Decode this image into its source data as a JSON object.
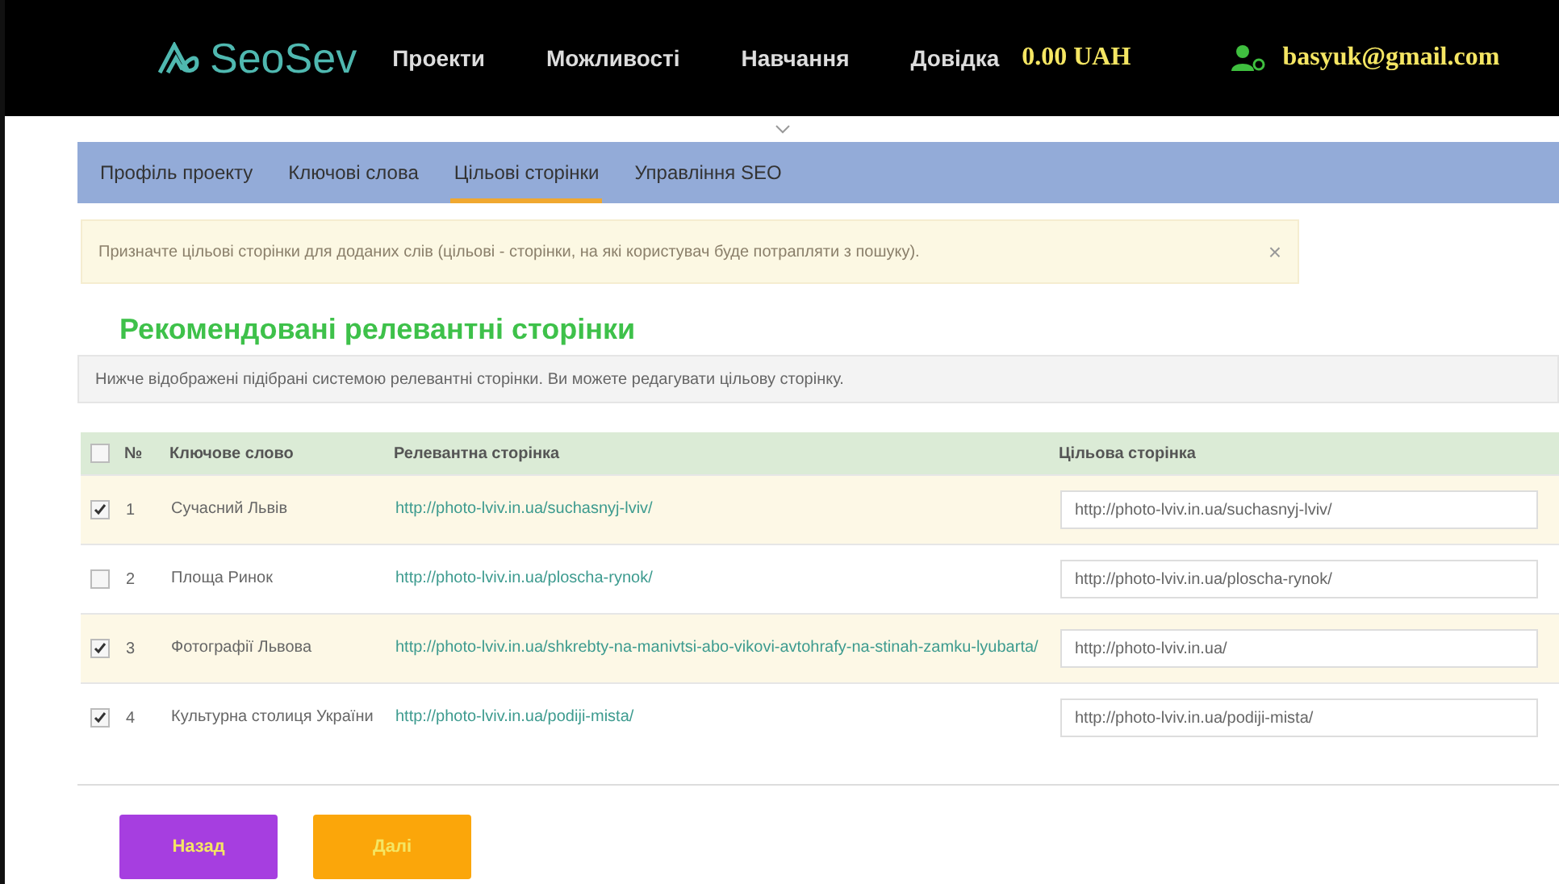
{
  "header": {
    "logo": "SeoSev",
    "menu": [
      "Проекти",
      "Можливості",
      "Навчання",
      "Довідка"
    ],
    "balance": "0.00 UAH",
    "user": "basyuk@gmail.com"
  },
  "tabs": [
    {
      "label": "Профіль проекту",
      "selected": false
    },
    {
      "label": "Ключові слова",
      "selected": false
    },
    {
      "label": "Цільові сторінки",
      "selected": true
    },
    {
      "label": "Управління SEO",
      "selected": false
    }
  ],
  "alert": {
    "text": "Призначте цільові сторінки для доданих слів (цільові - сторінки, на які користувач буде потрапляти з пошуку).",
    "close": "×"
  },
  "heading": "Рекомендовані релевантні сторінки",
  "info": "Нижче відображені підібрані системою релевантні сторінки. Ви можете редагувати цільову сторінку.",
  "table": {
    "all_checked": false,
    "columns": [
      "№",
      "Ключове слово",
      "Релевантна сторінка",
      "Цільова сторінка"
    ],
    "rows": [
      {
        "checked": true,
        "number": "1",
        "keyword": "Сучасний Львів",
        "relevant": "http://photo-lviv.in.ua/suchasnyj-lviv/",
        "target": "http://photo-lviv.in.ua/suchasnyj-lviv/"
      },
      {
        "checked": false,
        "number": "2",
        "keyword": "Площа Ринок",
        "relevant": "http://photo-lviv.in.ua/ploscha-rynok/",
        "target": "http://photo-lviv.in.ua/ploscha-rynok/"
      },
      {
        "checked": true,
        "number": "3",
        "keyword": "Фотографії Львова",
        "relevant": "http://photo-lviv.in.ua/shkrebty-na-manivtsi-abo-vikovi-avtohrafy-na-stinah-zamku-lyubarta/",
        "target": "http://photo-lviv.in.ua/"
      },
      {
        "checked": true,
        "number": "4",
        "keyword": "Культурна столиця України",
        "relevant": "http://photo-lviv.in.ua/podiji-mista/",
        "target": "http://photo-lviv.in.ua/podiji-mista/"
      }
    ]
  },
  "buttons": [
    {
      "label": "Назад",
      "kind": "back"
    },
    {
      "label": "Далі",
      "kind": "next"
    }
  ]
}
